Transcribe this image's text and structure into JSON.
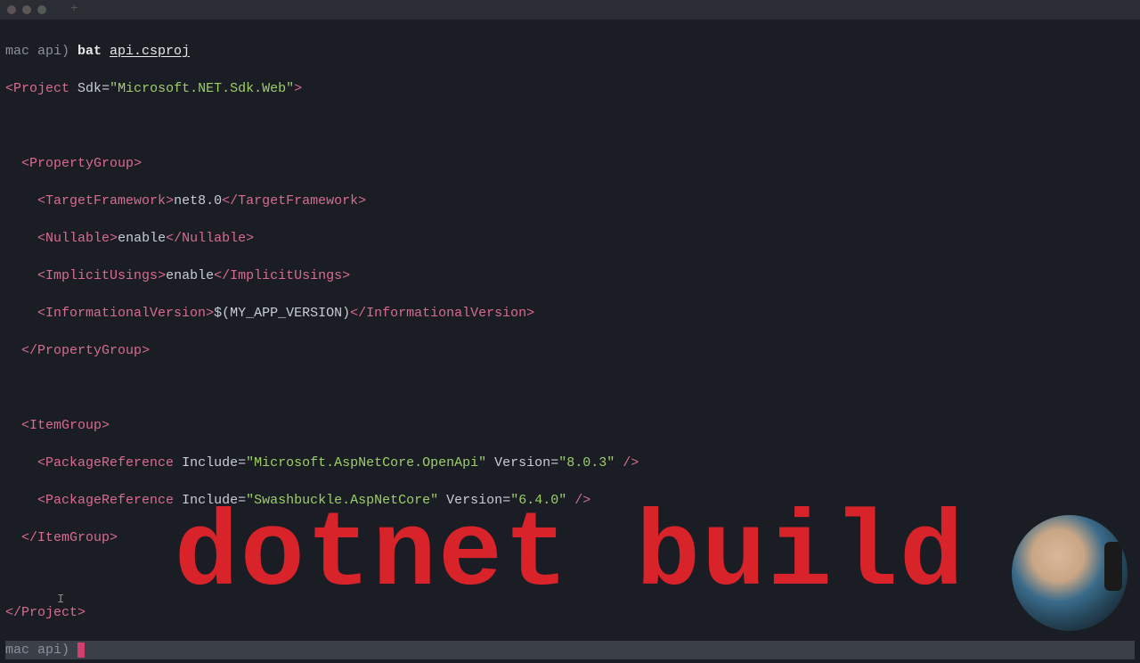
{
  "titlebar": {
    "plus": "+"
  },
  "prompt1": {
    "host": "mac api) ",
    "cmd": "bat ",
    "file": "api.csproj"
  },
  "xml": {
    "l1": {
      "open": "<",
      "tag": "Project",
      "sp": " ",
      "attr": "Sdk",
      "eq": "=",
      "val": "\"Microsoft.NET.Sdk.Web\"",
      "close": ">"
    },
    "pg_open": {
      "indent": "  ",
      "open": "<",
      "tag": "PropertyGroup",
      "close": ">"
    },
    "tf": {
      "indent": "    ",
      "open": "<",
      "tag": "TargetFramework",
      "close": ">",
      "val": "net8.0",
      "open2": "</",
      "close2": ">"
    },
    "nl": {
      "indent": "    ",
      "open": "<",
      "tag": "Nullable",
      "close": ">",
      "val": "enable",
      "open2": "</",
      "close2": ">"
    },
    "iu": {
      "indent": "    ",
      "open": "<",
      "tag": "ImplicitUsings",
      "close": ">",
      "val": "enable",
      "open2": "</",
      "close2": ">"
    },
    "iv": {
      "indent": "    ",
      "open": "<",
      "tag": "InformationalVersion",
      "close": ">",
      "val": "$(MY_APP_VERSION)",
      "open2": "</",
      "close2": ">"
    },
    "pg_close": {
      "indent": "  ",
      "open": "</",
      "tag": "PropertyGroup",
      "close": ">"
    },
    "ig_open": {
      "indent": "  ",
      "open": "<",
      "tag": "ItemGroup",
      "close": ">"
    },
    "pr1": {
      "indent": "    ",
      "open": "<",
      "tag": "PackageReference",
      "sp": " ",
      "a1": "Include",
      "eq": "=",
      "v1": "\"Microsoft.AspNetCore.OpenApi\"",
      "sp2": " ",
      "a2": "Version",
      "v2": "\"8.0.3\"",
      "close": " />"
    },
    "pr2": {
      "indent": "    ",
      "open": "<",
      "tag": "PackageReference",
      "sp": " ",
      "a1": "Include",
      "eq": "=",
      "v1": "\"Swashbuckle.AspNetCore\"",
      "sp2": " ",
      "a2": "Version",
      "v2": "\"6.4.0\"",
      "close": " />"
    },
    "ig_close": {
      "indent": "  ",
      "open": "</",
      "tag": "ItemGroup",
      "close": ">"
    },
    "proj_close": {
      "open": "</",
      "tag": "Project",
      "close": ">"
    }
  },
  "prompt2": {
    "host": "mac api) "
  },
  "overlay": "dotnet build"
}
